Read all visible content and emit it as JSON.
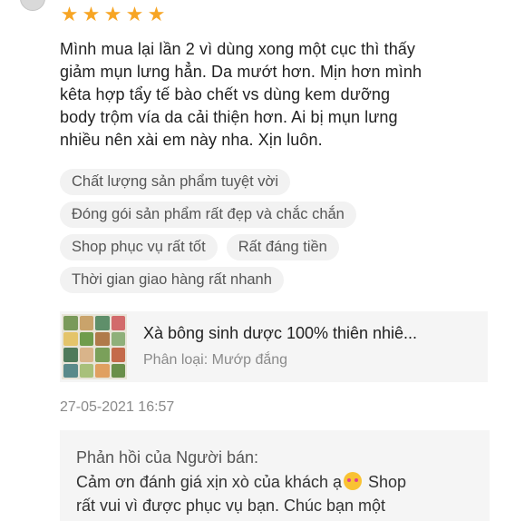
{
  "review": {
    "rating": 5,
    "stars": [
      "★",
      "★",
      "★",
      "★",
      "★"
    ],
    "text_lines": [
      "Mình mua lại lần 2 vì dùng xong một cục thì thấy",
      "giảm mụn lưng hẳn. Da mướt hơn. Mịn hơn mình",
      "kêta hợp tẩy tế bào chết vs dùng kem dưỡng",
      "body trộm vía da cải thiện hơn. Ai bị mụn lưng",
      "nhiều nên xài em này nha. Xịn luôn."
    ],
    "tags": [
      [
        "Chất lượng sản phẩm tuyệt vời"
      ],
      [
        "Đóng gói sản phẩm rất đẹp và chắc chắn"
      ],
      [
        "Shop phục vụ rất tốt",
        "Rất đáng tiền"
      ],
      [
        "Thời gian giao hàng rất nhanh"
      ]
    ],
    "colors": {
      "star": "#f7a524",
      "tag_bg": "#f2f2f2",
      "card_bg": "#f5f5f5",
      "muted_text": "#8a8a8a",
      "emoji": "#f9c233"
    }
  },
  "product": {
    "name": "Xà bông sinh dược 100% thiên nhiê...",
    "variant": "Phân loại: Mướp đắng",
    "thumb_icon": "product-thumbnail-image"
  },
  "timestamp": "27-05-2021 16:57",
  "seller_reply": {
    "heading": "Phản hồi của Người bán:",
    "line1_before_emoji": "Cảm ơn đánh giá xịn xò của khách ạ",
    "emoji_icon": "smiling-face-with-hearts-icon",
    "line1_after_emoji": " Shop",
    "line2": "rất vui vì được phục vụ bạn. Chúc bạn một"
  }
}
